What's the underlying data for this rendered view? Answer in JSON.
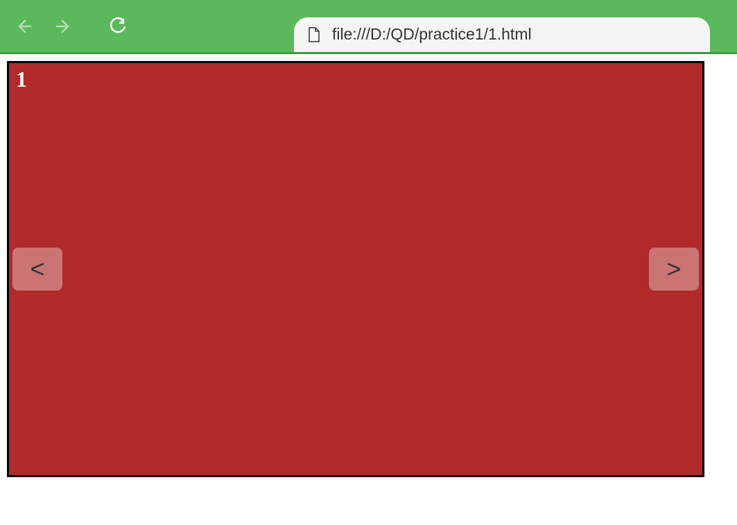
{
  "browser": {
    "url": "file:///D:/QD/practice1/1.html"
  },
  "carousel": {
    "current_slide": "1",
    "prev_label": "<",
    "next_label": ">",
    "background_color": "#b02a2a"
  }
}
